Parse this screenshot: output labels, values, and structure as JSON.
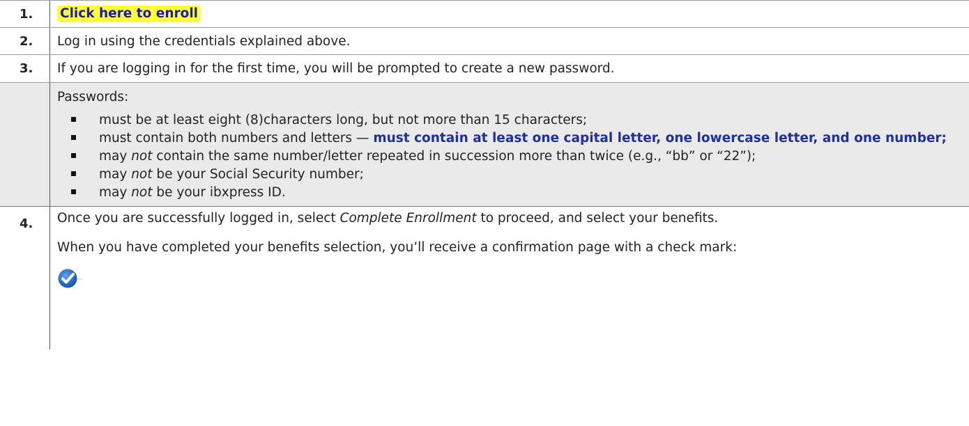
{
  "steps": {
    "step1": {
      "num": "1.",
      "link_label": "Click here to enroll"
    },
    "step2": {
      "num": "2.",
      "text": "Log in using the credentials explained above."
    },
    "step3": {
      "num": "3.",
      "text": "If you are logging in for the first time, you will be prompted to create a new password.",
      "passwords_heading": "Passwords:",
      "rules": {
        "r1": "must be at least eight (8)characters long, but not more than 15 characters;",
        "r2_plain": "must contain both numbers and letters — ",
        "r2_emph": "must contain at least one capital letter, one lowercase letter, and one number;",
        "r3_a": "may ",
        "r3_not": "not",
        "r3_b": " contain the same number/letter repeated in succession more than twice (e.g., “bb” or “22”);",
        "r4_a": "may ",
        "r4_not": "not",
        "r4_b": " be your Social Security number;",
        "r5_a": "may ",
        "r5_not": "not",
        "r5_b": " be your ibxpress ID."
      }
    },
    "step4": {
      "num": "4.",
      "p1_a": "Once you are successfully logged in, select ",
      "p1_em": "Complete Enrollment",
      "p1_b": " to proceed, and select your benefits.",
      "p2": "When you have completed your benefits selection, you’ll receive a confirmation page with a check mark:"
    }
  },
  "colors": {
    "highlight": "#ffff33",
    "link": "#1a1ab0",
    "emphasis": "#1f2f9e",
    "shade": "#eaeaea",
    "check": "#1e63b8"
  },
  "icons": {
    "confirmation": "check-mark-icon"
  }
}
